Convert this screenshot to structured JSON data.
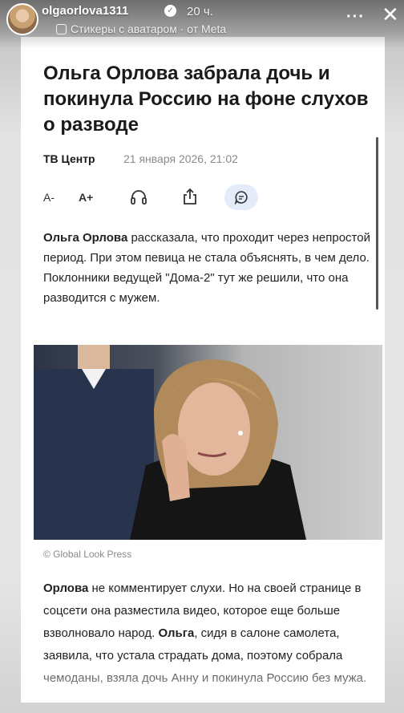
{
  "story": {
    "username": "olgaorlova1311",
    "time_ago": "20 ч.",
    "sticker_label": "Стикеры с аватаром · от Meta"
  },
  "article": {
    "title": "Ольга Орлова забрала дочь и покинула Россию на фоне слухов о разводе",
    "source": "ТВ Центр",
    "date": "21 января 2026, 21:02",
    "toolbar": {
      "font_smaller": "A-",
      "font_larger": "A+"
    },
    "p1_name": "Ольга Орлова",
    "p1_text": " рассказала, что проходит через непростой период. При этом певица не стала объяснять, в чем дело. Поклонники ведущей \"Дома-2\" тут же решили, что она разводится с мужем.",
    "photo_credit": "© Global Look Press",
    "p2_name": "Орлова",
    "p2_text_a": " не комментирует слухи. Но на своей странице в соцсети она разместила видео, которое еще больше взволновало народ. ",
    "p2_name_b": "Ольга",
    "p2_text_b": ", сидя в салоне самолета, заявила, что устала страдать дома, поэтому собрала чемоданы, взяла дочь Анну и покинула Россию без мужа."
  },
  "colors": {
    "accent_bubble": "#e4ecfa",
    "text": "#1a1a1a",
    "muted": "#8a8a8a"
  },
  "icons": [
    "verified-icon",
    "sticker-icon",
    "more-icon",
    "close-icon",
    "headphones-icon",
    "share-icon",
    "comment-icon"
  ]
}
